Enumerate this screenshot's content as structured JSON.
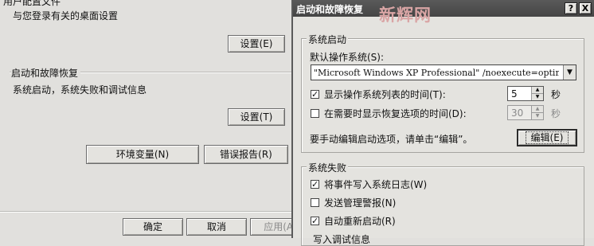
{
  "background_dialog": {
    "profile_heading": "用户配置文件",
    "profile_desc": "与您登录有关的桌面设置",
    "profile_settings_button": "设置(E)",
    "startup_heading": "启动和故障恢复",
    "startup_desc": "系统启动，系统失败和调试信息",
    "startup_settings_button": "设置(T)",
    "env_vars_button": "环境变量(N)",
    "error_report_button": "错误报告(R)",
    "ok_button": "确定",
    "cancel_button": "取消",
    "apply_button": "应用(A)"
  },
  "dialog": {
    "title": "启动和故障恢复",
    "watermark": "新辉网",
    "help_button": "?",
    "close_button": "X",
    "system_startup": {
      "group_title": "系统启动",
      "default_os_label": "默认操作系统(S):",
      "default_os_value": "\"Microsoft Windows XP Professional\" /noexecute=optin",
      "show_os_list_label": "显示操作系统列表的时间(T):",
      "show_os_list_checked": true,
      "show_os_list_value": "5",
      "show_recovery_label": "在需要时显示恢复选项的时间(D):",
      "show_recovery_checked": false,
      "show_recovery_value": "30",
      "seconds_unit": "秒",
      "manual_edit_text": "要手动编辑启动选项，请单击“编辑”。",
      "edit_button": "编辑(E)"
    },
    "system_failure": {
      "group_title": "系统失败",
      "write_event_label": "将事件写入系统日志(W)",
      "write_event_checked": true,
      "send_alert_label": "发送管理警报(N)",
      "send_alert_checked": false,
      "auto_restart_label": "自动重新启动(R)",
      "auto_restart_checked": true,
      "debug_info_label": "写入调试信息"
    }
  },
  "icons": {
    "check_glyph": "✓",
    "spin_up": "▲",
    "spin_down": "▼",
    "dropdown": "▼"
  }
}
